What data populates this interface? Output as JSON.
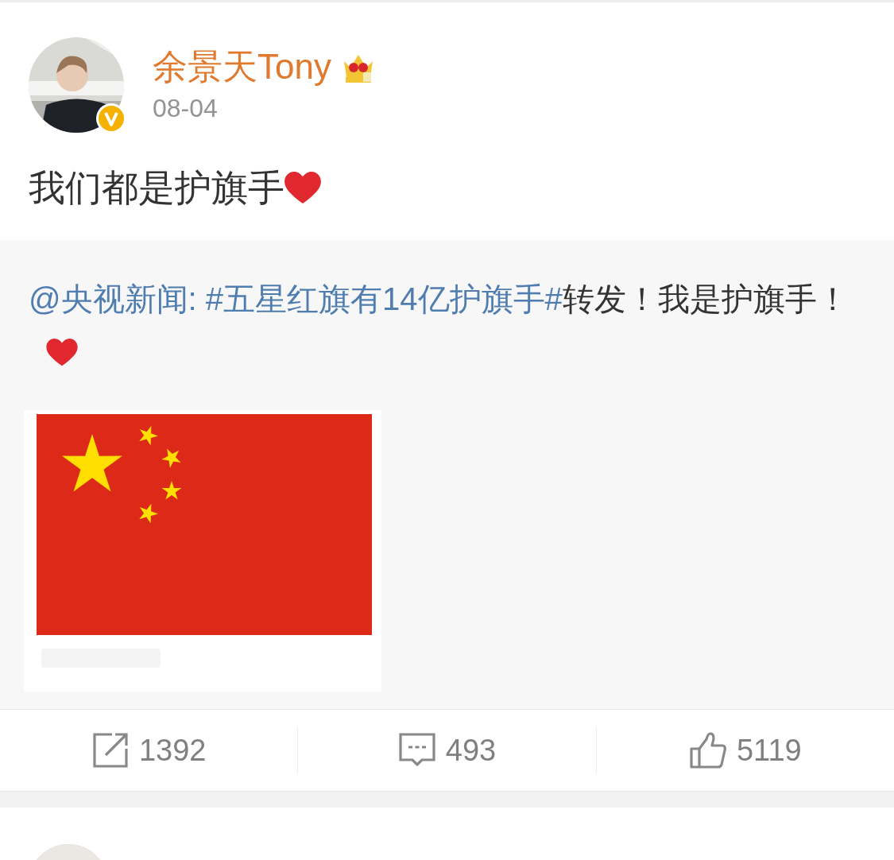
{
  "post": {
    "author": "余景天Tony",
    "date": "08-04",
    "text": "我们都是护旗手",
    "repost": {
      "mention": "@央视新闻:",
      "topic": "#五星红旗有14亿护旗手#",
      "text": "转发！我是护旗手！"
    },
    "actions": [
      {
        "kind": "repost",
        "count": "1392"
      },
      {
        "kind": "comment",
        "count": "493"
      },
      {
        "kind": "like",
        "count": "5119"
      }
    ]
  }
}
